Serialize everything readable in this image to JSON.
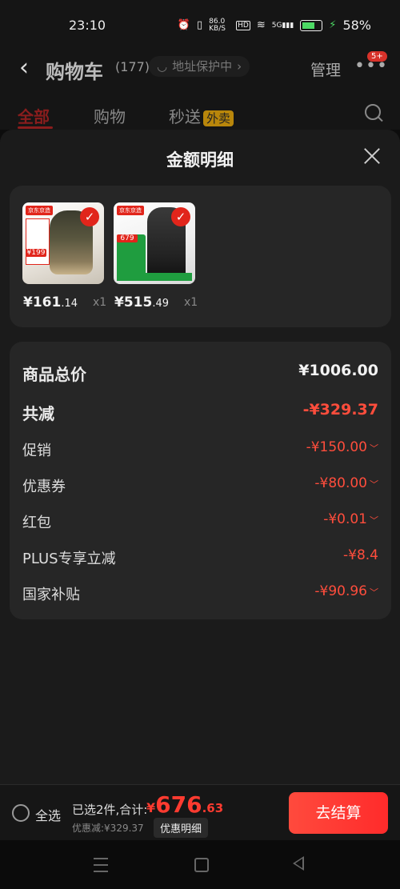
{
  "status_bar": {
    "time": "23:10",
    "network_speed": "86.0 KB/S",
    "hd": "HD",
    "signal": "5G",
    "battery": "58%"
  },
  "header": {
    "title": "购物车",
    "count": "(177)",
    "address_chip": "地址保护中",
    "manage": "管理",
    "badge": "5+"
  },
  "tabs": [
    {
      "label": "全部",
      "active": true
    },
    {
      "label": "购物",
      "active": false
    },
    {
      "label": "秒送",
      "active": false,
      "tag": "外卖"
    }
  ],
  "sheet": {
    "title": "金额明细",
    "products": [
      {
        "price_int": "¥161",
        "price_dec": ".14",
        "qty": "x1",
        "img_tag": "京东京造",
        "img_price": "¥199"
      },
      {
        "price_int": "¥515",
        "price_dec": ".49",
        "qty": "x1",
        "img_tag": "京东京造",
        "img_price": "679"
      }
    ],
    "total_label": "商品总价",
    "total_value": "¥1006.00",
    "discount_label": "共减",
    "discount_value": "-¥329.37",
    "lines": [
      {
        "label": "促销",
        "value": "-¥150.00",
        "chevron": true
      },
      {
        "label": "优惠券",
        "value": "-¥80.00",
        "chevron": true
      },
      {
        "label": "红包",
        "value": "-¥0.01",
        "chevron": true
      },
      {
        "label": "PLUS专享立减",
        "value": "-¥8.4",
        "chevron": false
      },
      {
        "label": "国家补贴",
        "value": "-¥90.96",
        "chevron": true
      }
    ]
  },
  "bottom_bar": {
    "select_all": "全选",
    "selected_text": "已选2件,合计:",
    "currency": "¥",
    "total_int": "676",
    "total_dec": ".63",
    "saving_text": "优惠减:¥329.37",
    "detail_chip": "优惠明细",
    "checkout": "去结算"
  },
  "colors": {
    "accent_red": "#ff3b30",
    "brand_red": "#e1251b",
    "background": "#1b1b1b"
  }
}
